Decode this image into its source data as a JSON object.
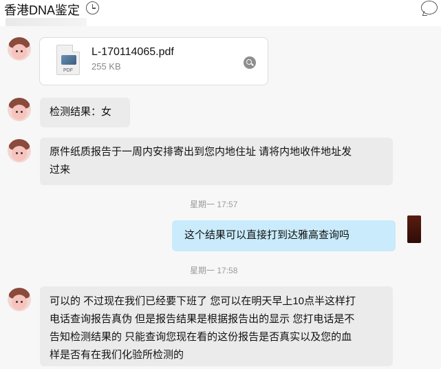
{
  "header": {
    "title": "香港DNA鉴定"
  },
  "messages": [
    {
      "type": "file",
      "file_name": "L-170114065.pdf",
      "file_size": "255 KB",
      "icon_label": "PDF"
    },
    {
      "type": "text",
      "lines": [
        "检测结果：女"
      ]
    },
    {
      "type": "text",
      "lines": [
        "原件纸质报告于一周内安排寄出到您内地住址 请将内地收件地址发",
        "过来"
      ]
    },
    {
      "type": "timestamp",
      "text": "星期一  17:57"
    },
    {
      "type": "outgoing",
      "lines": [
        "这个结果可以直接打到达雅高查询吗"
      ]
    },
    {
      "type": "timestamp",
      "text": "星期一  17:58"
    },
    {
      "type": "text",
      "lines": [
        "可以的 不过现在我们已经要下班了 您可以在明天早上10点半这样打",
        "电话查询报告真伪 但是报告结果是根据报告出的显示 您打电话是不",
        "告知检测结果的 只能查询您现在看的这份报告是否真实以及您的血",
        "样是否有在我们化验所检测的"
      ]
    }
  ]
}
